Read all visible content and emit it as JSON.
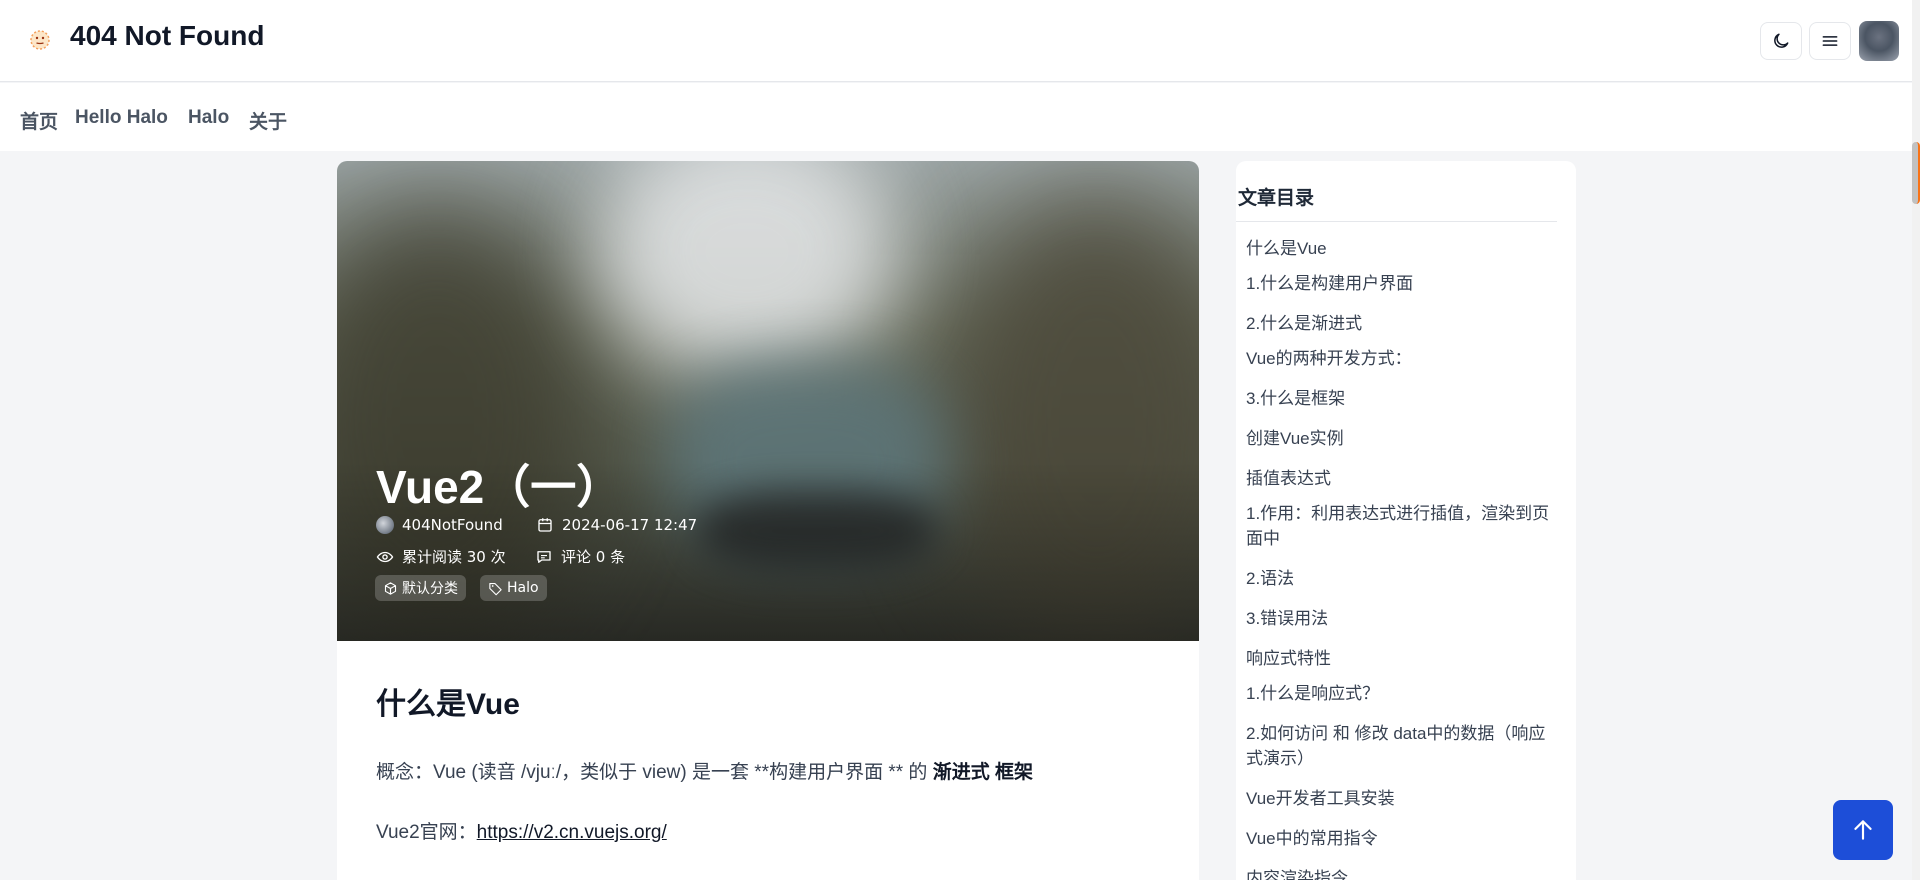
{
  "site": {
    "title": "404 Not Found"
  },
  "nav": {
    "items": [
      "首页",
      "Hello Halo",
      "Halo",
      "关于"
    ]
  },
  "post": {
    "title": "Vue2（一）",
    "author": "404NotFound",
    "date": "2024-06-17 12:47",
    "views": "累计阅读 30 次",
    "comments": "评论 0 条",
    "tags": [
      "默认分类",
      "Halo"
    ]
  },
  "content": {
    "h2": "什么是Vue",
    "p1_prefix": "概念：Vue (读音 /vjuː/，类似于 view) 是一套 **构建用户界面 ** 的 ",
    "p1_bold": "渐进式 框架",
    "p2_prefix": "Vue2官网：",
    "p2_link": "https://v2.cn.vuejs.org/"
  },
  "toc": {
    "title": "文章目录",
    "items": [
      "什么是Vue",
      "1.什么是构建用户界面",
      "2.什么是渐进式",
      "Vue的两种开发方式：",
      "3.什么是框架",
      "创建Vue实例",
      "插值表达式",
      "1.作用：利用表达式进行插值，渲染到页面中",
      "2.语法",
      "3.错误用法",
      "响应式特性",
      "1.什么是响应式？",
      "2.如何访问 和 修改 data中的数据（响应式演示）",
      "Vue开发者工具安装",
      "Vue中的常用指令",
      "内容渲染指令"
    ]
  },
  "icons": {
    "logo": "smiley-sun-icon",
    "theme": "moon-icon",
    "menu": "hamburger-menu-icon",
    "backtop": "arrow-up-icon"
  },
  "colors": {
    "accent": "#1d4ed8"
  }
}
